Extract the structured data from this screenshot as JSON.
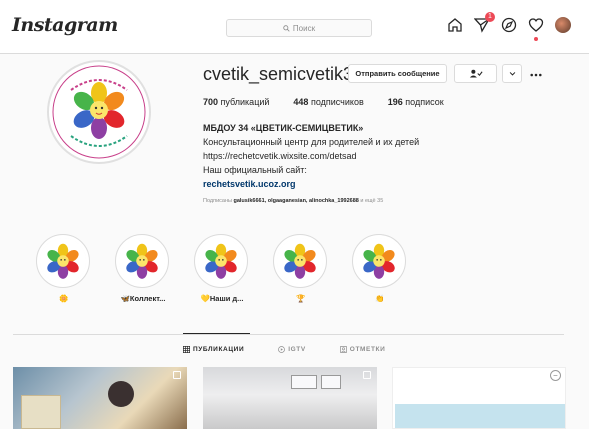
{
  "nav": {
    "logo": "Instagram",
    "search_placeholder": "Поиск",
    "notifications_count": "1"
  },
  "profile": {
    "username": "cvetik_semicvetik34",
    "message_button": "Отправить сообщение",
    "stats": {
      "posts_count": "700",
      "posts_label": "публикаций",
      "followers_count": "448",
      "followers_label": "подписчиков",
      "following_count": "196",
      "following_label": "подписок"
    },
    "bio": {
      "name": "МБДОУ 34 «ЦВЕТИК-СЕМИЦВЕТИК»",
      "line1": "Консультационный центр для родителей и их детей",
      "line2": "https://rechetcvetik.wixsite.com/detsad",
      "line3": "Наш официальный сайт:",
      "link": "rechetsvetik.ucoz.org"
    },
    "followed_by_prefix": "Подписаны",
    "followed_by_names": "galusik6661, olgaaganesian, alinochka_1992688",
    "followed_by_suffix": "и ещё 35"
  },
  "highlights": [
    {
      "label": "🌼"
    },
    {
      "label": "🦋Коллект..."
    },
    {
      "label": "💛Наши д..."
    },
    {
      "label": "🏆"
    },
    {
      "label": "👏"
    }
  ],
  "tabs": {
    "posts": "ПУБЛИКАЦИИ",
    "igtv": "IGTV",
    "tagged": "ОТМЕТКИ"
  },
  "colors": {
    "accent_link": "#00376b",
    "badge": "#ed4956",
    "border": "#dbdbdb"
  }
}
